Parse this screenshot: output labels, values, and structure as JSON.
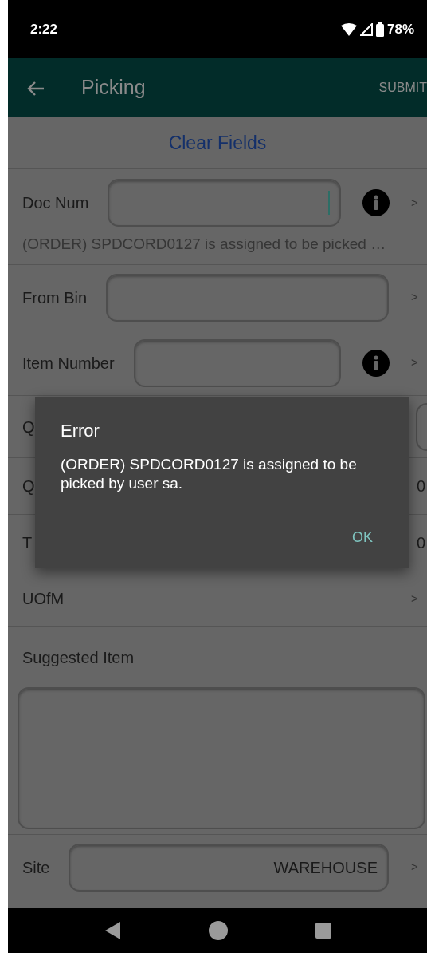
{
  "status_bar": {
    "time": "2:22",
    "battery": "78%"
  },
  "app_bar": {
    "title": "Picking",
    "action": "SUBMIT"
  },
  "clear_button": "Clear Fields",
  "rows": [
    {
      "kind": "field",
      "label": "Doc Num",
      "focused": true,
      "info": true,
      "chevron": ">",
      "hint": "(ORDER) SPDCORD0127 is assigned to be picked …"
    },
    {
      "kind": "field",
      "label": "From Bin",
      "focused": false,
      "info": false,
      "chevron": ">"
    },
    {
      "kind": "field",
      "label": "Item Number",
      "focused": false,
      "info": true,
      "chevron": ">"
    },
    {
      "kind": "covered",
      "label": "Q",
      "field": true
    },
    {
      "kind": "covered",
      "label": "Q",
      "value": "0"
    },
    {
      "kind": "covered",
      "label": "T",
      "value": "0"
    },
    {
      "kind": "plain",
      "label": "UOfM",
      "chevron": ">"
    },
    {
      "kind": "textarea",
      "label": "Suggested Item"
    },
    {
      "kind": "field",
      "label": "Site",
      "value": "WAREHOUSE",
      "focused": false,
      "info": false,
      "chevron": ">"
    }
  ],
  "dialog": {
    "title": "Error",
    "message": "(ORDER) SPDCORD0127 is assigned to be picked by user sa.",
    "button": "OK"
  }
}
